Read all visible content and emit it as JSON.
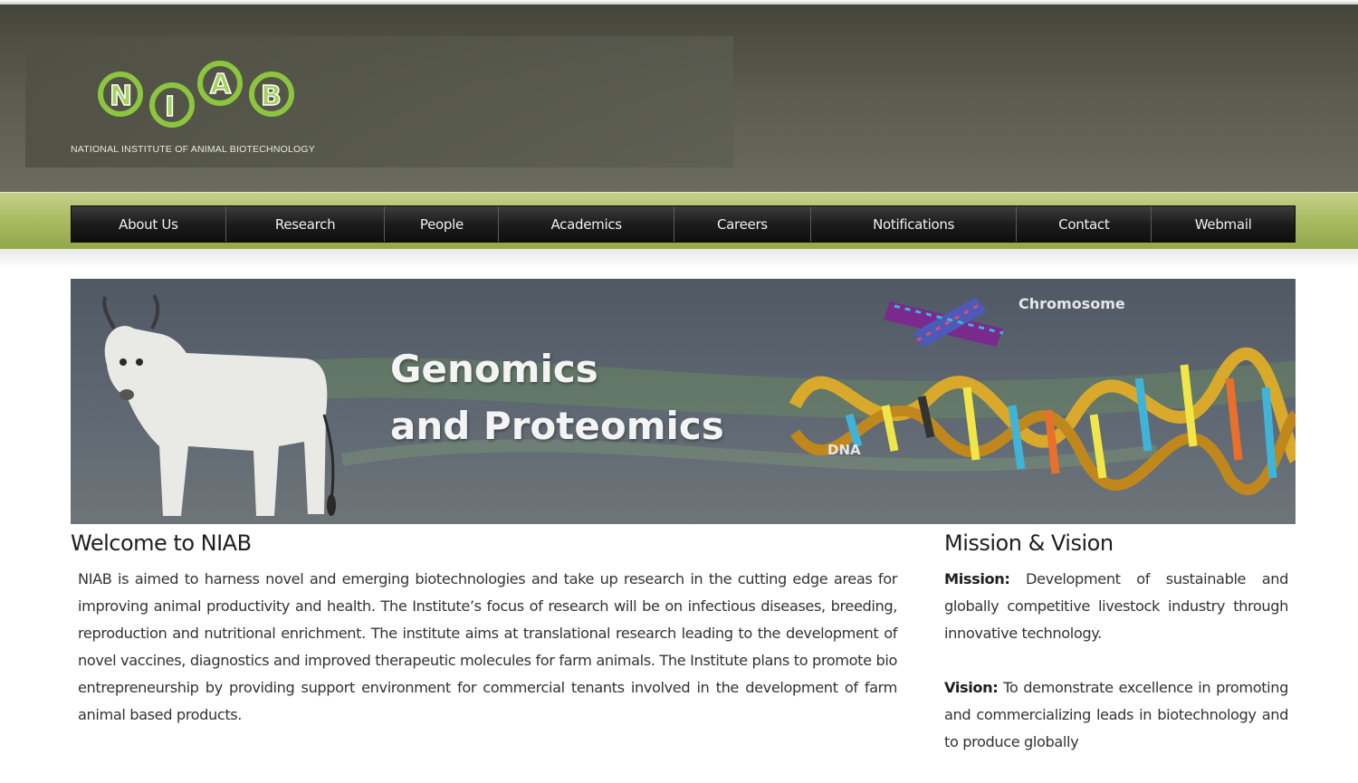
{
  "header": {
    "logo_text": "NATIONAL INSTITUTE OF ANIMAL BIOTECHNOLOGY",
    "logo_letters": [
      "N",
      "I",
      "A",
      "B"
    ]
  },
  "nav": {
    "items": [
      {
        "label": "About Us"
      },
      {
        "label": "Research"
      },
      {
        "label": "People"
      },
      {
        "label": "Academics"
      },
      {
        "label": "Careers"
      },
      {
        "label": "Notifications"
      },
      {
        "label": "Contact"
      },
      {
        "label": "Webmail"
      }
    ]
  },
  "banner": {
    "title_line1": "Genomics",
    "title_line2": "and Proteomics",
    "label_chromosome": "Chromosome",
    "label_dna": "DNA"
  },
  "welcome": {
    "heading": "Welcome to NIAB",
    "body": "NIAB is aimed to harness novel and emerging biotechnologies and take up research in the cutting edge areas for improving animal productivity and health. The Institute’s focus of research will be on infectious diseases, breeding, reproduction and nutritional enrichment. The institute aims at translational research leading to the development of novel vaccines, diagnostics and improved therapeutic molecules for farm animals. The Institute plans to promote bio entrepreneurship by providing support environment for commercial tenants involved in the development of farm animal based products."
  },
  "mission": {
    "heading": "Mission & Vision",
    "mission_label": "Mission:",
    "mission_text": " Development of sustainable and globally competitive livestock industry through innovative technology.",
    "vision_label": "Vision:",
    "vision_text": " To demonstrate excellence in promoting and commercializing leads in biotechnology and to produce globally"
  },
  "colors": {
    "header_dark": "#45453a",
    "nav_green": "#a9ba60",
    "logo_green": "#8cc63f"
  }
}
